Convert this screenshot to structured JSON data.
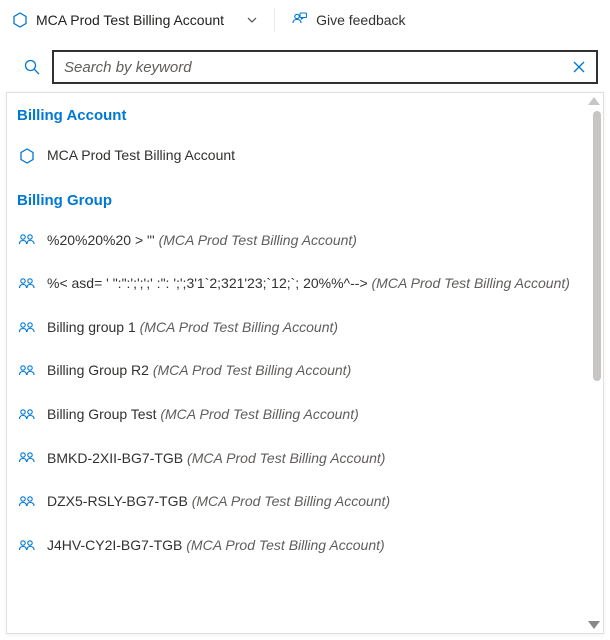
{
  "topbar": {
    "scope_label": "MCA Prod Test Billing Account",
    "feedback_label": "Give feedback"
  },
  "search": {
    "placeholder": "Search by keyword",
    "value": ""
  },
  "sections": [
    {
      "title": "Billing Account",
      "icon": "hexagon",
      "items": [
        {
          "name": "MCA Prod Test Billing Account",
          "suffix": ""
        }
      ]
    },
    {
      "title": "Billing Group",
      "icon": "group",
      "items": [
        {
          "name": "%20%20%20 > \"'",
          "suffix": "(MCA Prod Test Billing Account)"
        },
        {
          "name": "%< asd= ' \":\":';';';' :\": ';';3'1`2;321'23;`12;`; 20%%^-->",
          "suffix": "(MCA Prod Test Billing Account)"
        },
        {
          "name": "Billing group 1",
          "suffix": "(MCA Prod Test Billing Account)"
        },
        {
          "name": "Billing Group R2",
          "suffix": "(MCA Prod Test Billing Account)"
        },
        {
          "name": "Billing Group Test",
          "suffix": "(MCA Prod Test Billing Account)"
        },
        {
          "name": "BMKD-2XII-BG7-TGB",
          "suffix": "(MCA Prod Test Billing Account)"
        },
        {
          "name": "DZX5-RSLY-BG7-TGB",
          "suffix": "(MCA Prod Test Billing Account)"
        },
        {
          "name": "J4HV-CY2I-BG7-TGB",
          "suffix": "(MCA Prod Test Billing Account)"
        }
      ]
    }
  ]
}
